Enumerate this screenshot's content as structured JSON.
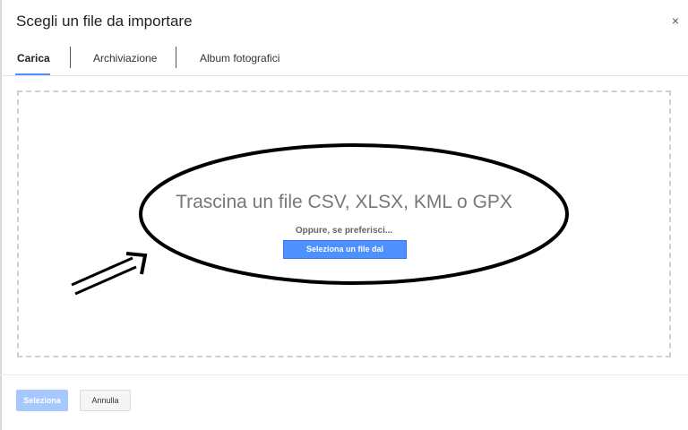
{
  "dialog": {
    "title": "Scegli un file da importare",
    "close_glyph": "×"
  },
  "tabs": [
    {
      "label": "Carica",
      "active": true
    },
    {
      "label": "Archiviazione",
      "active": false
    },
    {
      "label": "Album fotografici",
      "active": false
    }
  ],
  "upload": {
    "drop_title": "Trascina un file CSV, XLSX, KML o GPX",
    "or_text": "Oppure, se preferisci...",
    "select_button": "Seleziona un file dal dispositivo"
  },
  "footer": {
    "select_label": "Seleziona",
    "cancel_label": "Annulla"
  },
  "colors": {
    "accent": "#4d90fe",
    "disabled_accent": "#a6c8ff"
  }
}
